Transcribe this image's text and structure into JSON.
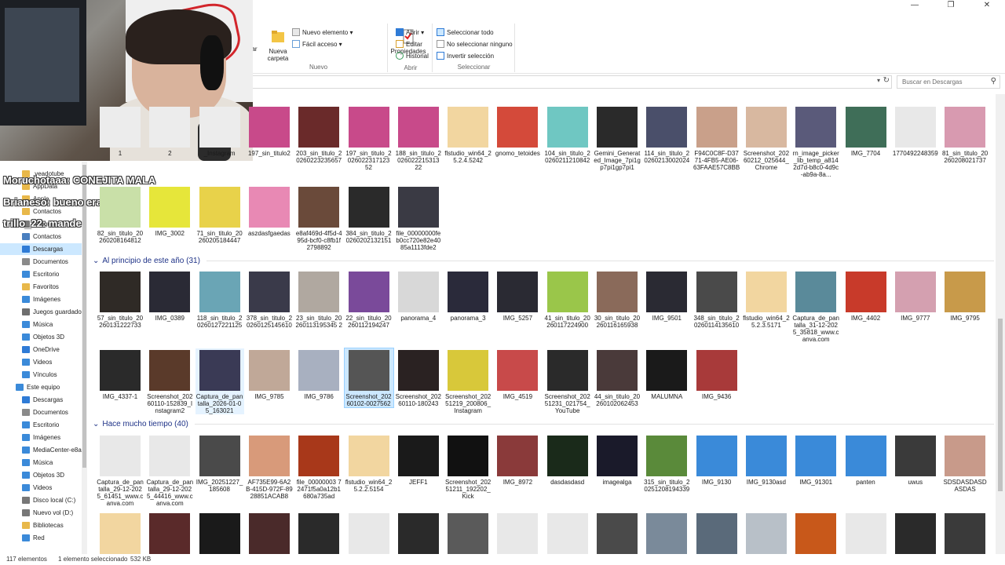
{
  "window": {
    "minimize": "—",
    "maximize": "❐",
    "close": "✕"
  },
  "ribbon": {
    "nuevo": {
      "group": "Nuevo",
      "nueva_carpeta": "Nueva carpeta",
      "nuevo_elemento": "Nuevo elemento ▾",
      "facil_acceso": "Fácil acceso ▾",
      "partial_left": "ar"
    },
    "abrir": {
      "group": "Abrir",
      "propiedades": "Propiedades",
      "abrir": "Abrir ▾",
      "editar": "Editar",
      "historial": "Historial"
    },
    "seleccionar": {
      "group": "Seleccionar",
      "todo": "Seleccionar todo",
      "ninguno": "No seleccionar ninguno",
      "invertir": "Invertir selección"
    }
  },
  "search": {
    "placeholder": "Buscar en Descargas"
  },
  "sidebar": [
    {
      "label": ".veadotube",
      "icon": "folder-icon",
      "color": "#e8b84a",
      "selected": false
    },
    {
      "label": "AppData",
      "icon": "folder-icon",
      "color": "#e8b84a",
      "selected": false
    },
    {
      "label": "Apple",
      "icon": "folder-icon",
      "color": "#e8b84a",
      "selected": false
    },
    {
      "label": "Contactos",
      "icon": "folder-icon",
      "color": "#e8b84a",
      "selected": false
    },
    {
      "label": "Búsquedas",
      "icon": "search-icon",
      "color": "#7a7a7a",
      "selected": false
    },
    {
      "label": "Contactos",
      "icon": "contacts-icon",
      "color": "#4a7fbf",
      "selected": false
    },
    {
      "label": "Descargas",
      "icon": "download-icon",
      "color": "#2f7bd6",
      "selected": true
    },
    {
      "label": "Documentos",
      "icon": "documents-icon",
      "color": "#8a8a8a",
      "selected": false
    },
    {
      "label": "Escritorio",
      "icon": "desktop-icon",
      "color": "#3b8ad9",
      "selected": false
    },
    {
      "label": "Favoritos",
      "icon": "star-icon",
      "color": "#e8b84a",
      "selected": false
    },
    {
      "label": "Imágenes",
      "icon": "images-icon",
      "color": "#3b8ad9",
      "selected": false
    },
    {
      "label": "Juegos guardado",
      "icon": "games-icon",
      "color": "#6e6e6e",
      "selected": false
    },
    {
      "label": "Música",
      "icon": "music-icon",
      "color": "#3b8ad9",
      "selected": false
    },
    {
      "label": "Objetos 3D",
      "icon": "cube-icon",
      "color": "#3b8ad9",
      "selected": false
    },
    {
      "label": "OneDrive",
      "icon": "cloud-icon",
      "color": "#2f7bd6",
      "selected": false
    },
    {
      "label": "Videos",
      "icon": "video-icon",
      "color": "#3b8ad9",
      "selected": false
    },
    {
      "label": "Vínculos",
      "icon": "link-icon",
      "color": "#3b8ad9",
      "selected": false
    },
    {
      "label": "Este equipo",
      "icon": "computer-icon",
      "color": "#3b8ad9",
      "selected": false
    },
    {
      "label": "Descargas",
      "icon": "download-icon",
      "color": "#2f7bd6",
      "selected": false
    },
    {
      "label": "Documentos",
      "icon": "documents-icon",
      "color": "#8a8a8a",
      "selected": false
    },
    {
      "label": "Escritorio",
      "icon": "desktop-icon",
      "color": "#3b8ad9",
      "selected": false
    },
    {
      "label": "Imágenes",
      "icon": "images-icon",
      "color": "#3b8ad9",
      "selected": false
    },
    {
      "label": "MediaCenter-e8a",
      "icon": "computer-icon",
      "color": "#3b8ad9",
      "selected": false
    },
    {
      "label": "Música",
      "icon": "music-icon",
      "color": "#3b8ad9",
      "selected": false
    },
    {
      "label": "Objetos 3D",
      "icon": "cube-icon",
      "color": "#3b8ad9",
      "selected": false
    },
    {
      "label": "Videos",
      "icon": "video-icon",
      "color": "#3b8ad9",
      "selected": false
    },
    {
      "label": "Disco local (C:)",
      "icon": "drive-icon",
      "color": "#777777",
      "selected": false
    },
    {
      "label": "Nuevo vol (D:)",
      "icon": "drive-icon",
      "color": "#777777",
      "selected": false
    },
    {
      "label": "Bibliotecas",
      "icon": "library-icon",
      "color": "#e8b84a",
      "selected": false
    },
    {
      "label": "Red",
      "icon": "network-icon",
      "color": "#3b8ad9",
      "selected": false
    }
  ],
  "chat": [
    {
      "name": "Moruchotaaa:",
      "msg": " CONEJITA MALA"
    },
    {
      "name": "Brianeso:",
      "msg": " bueno era"
    },
    {
      "name": "trillo_22:",
      "msg": " mande"
    }
  ],
  "groups": {
    "g1": "Al principio de este año (31)",
    "g2": "Hace mucho tiempo (40)"
  },
  "row0": [
    {
      "label": "1",
      "color": "#ececec"
    },
    {
      "label": "2",
      "color": "#ececec"
    },
    {
      "label": "_Instagram",
      "color": "#ececec"
    },
    {
      "label": "197_sin_titulo2",
      "color": "#c84a8a"
    },
    {
      "label": "203_sin_titulo_20260223235657",
      "color": "#6a2a2a"
    },
    {
      "label": "197_sin_titulo_2026022317123 52",
      "color": "#c84a8a"
    },
    {
      "label": "188_sin_titulo_2026022215313 22",
      "color": "#c84a8a"
    },
    {
      "label": "flstudio_win64_25.2.4.5242",
      "color": "#f2d6a0"
    },
    {
      "label": "gnomo_tetoides",
      "color": "#d44a3a"
    },
    {
      "label": "104_sin_titulo_20260211210842",
      "color": "#6fc7c2"
    },
    {
      "label": "Gemini_Generated_Image_7pi1gp7pi1gp7pi1",
      "color": "#2a2a2a"
    },
    {
      "label": "114_sin_titulo_20260213002024",
      "color": "#4a4f6a"
    },
    {
      "label": "F94C0C8F-D3771-4FB5-AE06-63FAAE57C8BB",
      "color": "#c9a08a"
    },
    {
      "label": "Screenshot_20260212_025644_Chrome",
      "color": "#d8b8a0"
    },
    {
      "label": "rn_image_picker_lib_temp_a8142d7d-b8c0-4d9c-ab9a-8a...",
      "color": "#5a5a7a"
    },
    {
      "label": "IMG_7704",
      "color": "#3f6e58"
    },
    {
      "label": "1770492248359",
      "color": "#e8e8e8"
    },
    {
      "label": "81_sin_titulo_20260208021737",
      "color": "#d89ab0"
    }
  ],
  "row1": [
    {
      "label": "82_sin_titulo_20260208164812",
      "color": "#c9e0a8"
    },
    {
      "label": "IMG_3002",
      "color": "#e6e63a"
    },
    {
      "label": "71_sin_titulo_20260205184447",
      "color": "#e8d24a"
    },
    {
      "label": "aszdasfgaedas",
      "color": "#e889b4"
    },
    {
      "label": "e8af469d-4f5d-495d-bcf0-c8fb1f2798892",
      "color": "#6a4a3a"
    },
    {
      "label": "384_sin_titulo_20260202132151",
      "color": "#2a2a2a"
    },
    {
      "label": "file_00000000feb0cc720e82e4085a1113fde2",
      "color": "#3a3a44"
    }
  ],
  "row2": [
    {
      "label": "57_sin_titulo_20260131222733",
      "color": "#2f2a26"
    },
    {
      "label": "IMG_0389",
      "color": "#2a2a35"
    },
    {
      "label": "118_sin_titulo_20260127221125",
      "color": "#6aa5b5"
    },
    {
      "label": "378_sin_titulo_20260125145610",
      "color": "#3a3a4a"
    },
    {
      "label": "23_sin_titulo_20260113195345 2",
      "color": "#b0a8a0"
    },
    {
      "label": "22_sin_titulo_20260112194247",
      "color": "#7a4a9a"
    },
    {
      "label": "panorama_4",
      "color": "#d8d8d8"
    },
    {
      "label": "panorama_3",
      "color": "#2a2a3a"
    },
    {
      "label": "IMG_5257",
      "color": "#2a2a33"
    },
    {
      "label": "41_sin_titulo_20260117224900",
      "color": "#9ac64a"
    },
    {
      "label": "30_sin_titulo_20260116165938",
      "color": "#8a6a5a"
    },
    {
      "label": "IMG_9501",
      "color": "#2a2a33"
    },
    {
      "label": "348_sin_titulo_20260114135610",
      "color": "#4a4a4a"
    },
    {
      "label": "flstudio_win64_25.2.3.5171",
      "color": "#f2d6a0"
    },
    {
      "label": "Captura_de_pantalla_31-12-2025_35818_www.canva.com",
      "color": "#5a8a9a"
    },
    {
      "label": "IMG_4402",
      "color": "#c83a2a"
    },
    {
      "label": "IMG_9777",
      "color": "#d4a0b0"
    },
    {
      "label": "IMG_9795",
      "color": "#c89a4a"
    }
  ],
  "row3": [
    {
      "label": "IMG_4337-1",
      "color": "#2a2a2a"
    },
    {
      "label": "Screenshot_20260110-152839_Instagram2",
      "color": "#5a3a2a"
    },
    {
      "label": "Captura_de_pantalla_2026-01-05_163021",
      "color": "#3a3a55"
    },
    {
      "label": "IMG_9785",
      "color": "#c0a898"
    },
    {
      "label": "IMG_9786",
      "color": "#a8b0c0"
    },
    {
      "label": "Screenshot_20260102-0027562",
      "color": "#555555"
    },
    {
      "label": "Screenshot_20260110-180243",
      "color": "#2a2222"
    },
    {
      "label": "Screenshot_20251219_200806_Instagram",
      "color": "#d8c83a"
    },
    {
      "label": "IMG_4519",
      "color": "#c84a4a"
    },
    {
      "label": "Screenshot_20251231_021754_YouTube",
      "color": "#2a2a2a"
    },
    {
      "label": "44_sin_titulo_20260102062453",
      "color": "#4a3a3a"
    },
    {
      "label": "MALUMNA",
      "color": "#1a1a1a"
    },
    {
      "label": "IMG_9436",
      "color": "#a83a3a"
    }
  ],
  "row4": [
    {
      "label": "Captura_de_pantalla_29-12-2025_61451_www.canva.com",
      "color": "#e8e8e8"
    },
    {
      "label": "Captura_de_pantalla_29-12-2025_44416_www.canva.com",
      "color": "#e8e8e8"
    },
    {
      "label": "IMG_20251227_185608",
      "color": "#4a4a4a"
    },
    {
      "label": "AF735E99-6A2B-415D-972F-8928851ACAB8",
      "color": "#d89a7a"
    },
    {
      "label": "file_00000003 72471f5a0a12b1680a735ad",
      "color": "#a8381a"
    },
    {
      "label": "flstudio_win64_25.2.2.5154",
      "color": "#f2d6a0"
    },
    {
      "label": "JEFF1",
      "color": "#1a1a1a"
    },
    {
      "label": "Screenshot_20251211_192202_Kick",
      "color": "#111111"
    },
    {
      "label": "IMG_8972",
      "color": "#8a3a3a"
    },
    {
      "label": "dasdasdasd",
      "color": "#1a2a1a"
    },
    {
      "label": "imagealga",
      "color": "#1a1a2a"
    },
    {
      "label": "315_sin_titulo_20251208194339",
      "color": "#5a8a3a"
    },
    {
      "label": "IMG_9130",
      "color": "#3a8ad9"
    },
    {
      "label": "IMG_9130asd",
      "color": "#3a8ad9"
    },
    {
      "label": "IMG_91301",
      "color": "#3a8ad9"
    },
    {
      "label": "panten",
      "color": "#3a8ad9"
    },
    {
      "label": "uwus",
      "color": "#3a3a3a"
    },
    {
      "label": "SDSDASDASDASDAS",
      "color": "#c89a8a"
    }
  ],
  "row5": [
    {
      "label": "",
      "color": "#f2d6a0"
    },
    {
      "label": "",
      "color": "#5a2a2a"
    },
    {
      "label": "",
      "color": "#1a1a1a"
    },
    {
      "label": "",
      "color": "#4a2a2a"
    },
    {
      "label": "",
      "color": "#2a2a2a"
    },
    {
      "label": "",
      "color": "#e8e8e8"
    },
    {
      "label": "",
      "color": "#2a2a2a"
    },
    {
      "label": "",
      "color": "#5a5a5a"
    },
    {
      "label": "",
      "color": "#e8e8e8"
    },
    {
      "label": "",
      "color": "#e8e8e8"
    },
    {
      "label": "",
      "color": "#4a4a4a"
    },
    {
      "label": "",
      "color": "#7a8a9a"
    },
    {
      "label": "",
      "color": "#5a6a7a"
    },
    {
      "label": "",
      "color": "#b8c0c8"
    },
    {
      "label": "",
      "color": "#c8581a"
    },
    {
      "label": "",
      "color": "#e8e8e8"
    },
    {
      "label": "",
      "color": "#2a2a2a"
    },
    {
      "label": "",
      "color": "#3a3a3a"
    }
  ],
  "status": {
    "count": "117 elementos",
    "selected": "1 elemento seleccionado",
    "size": "532 KB"
  }
}
